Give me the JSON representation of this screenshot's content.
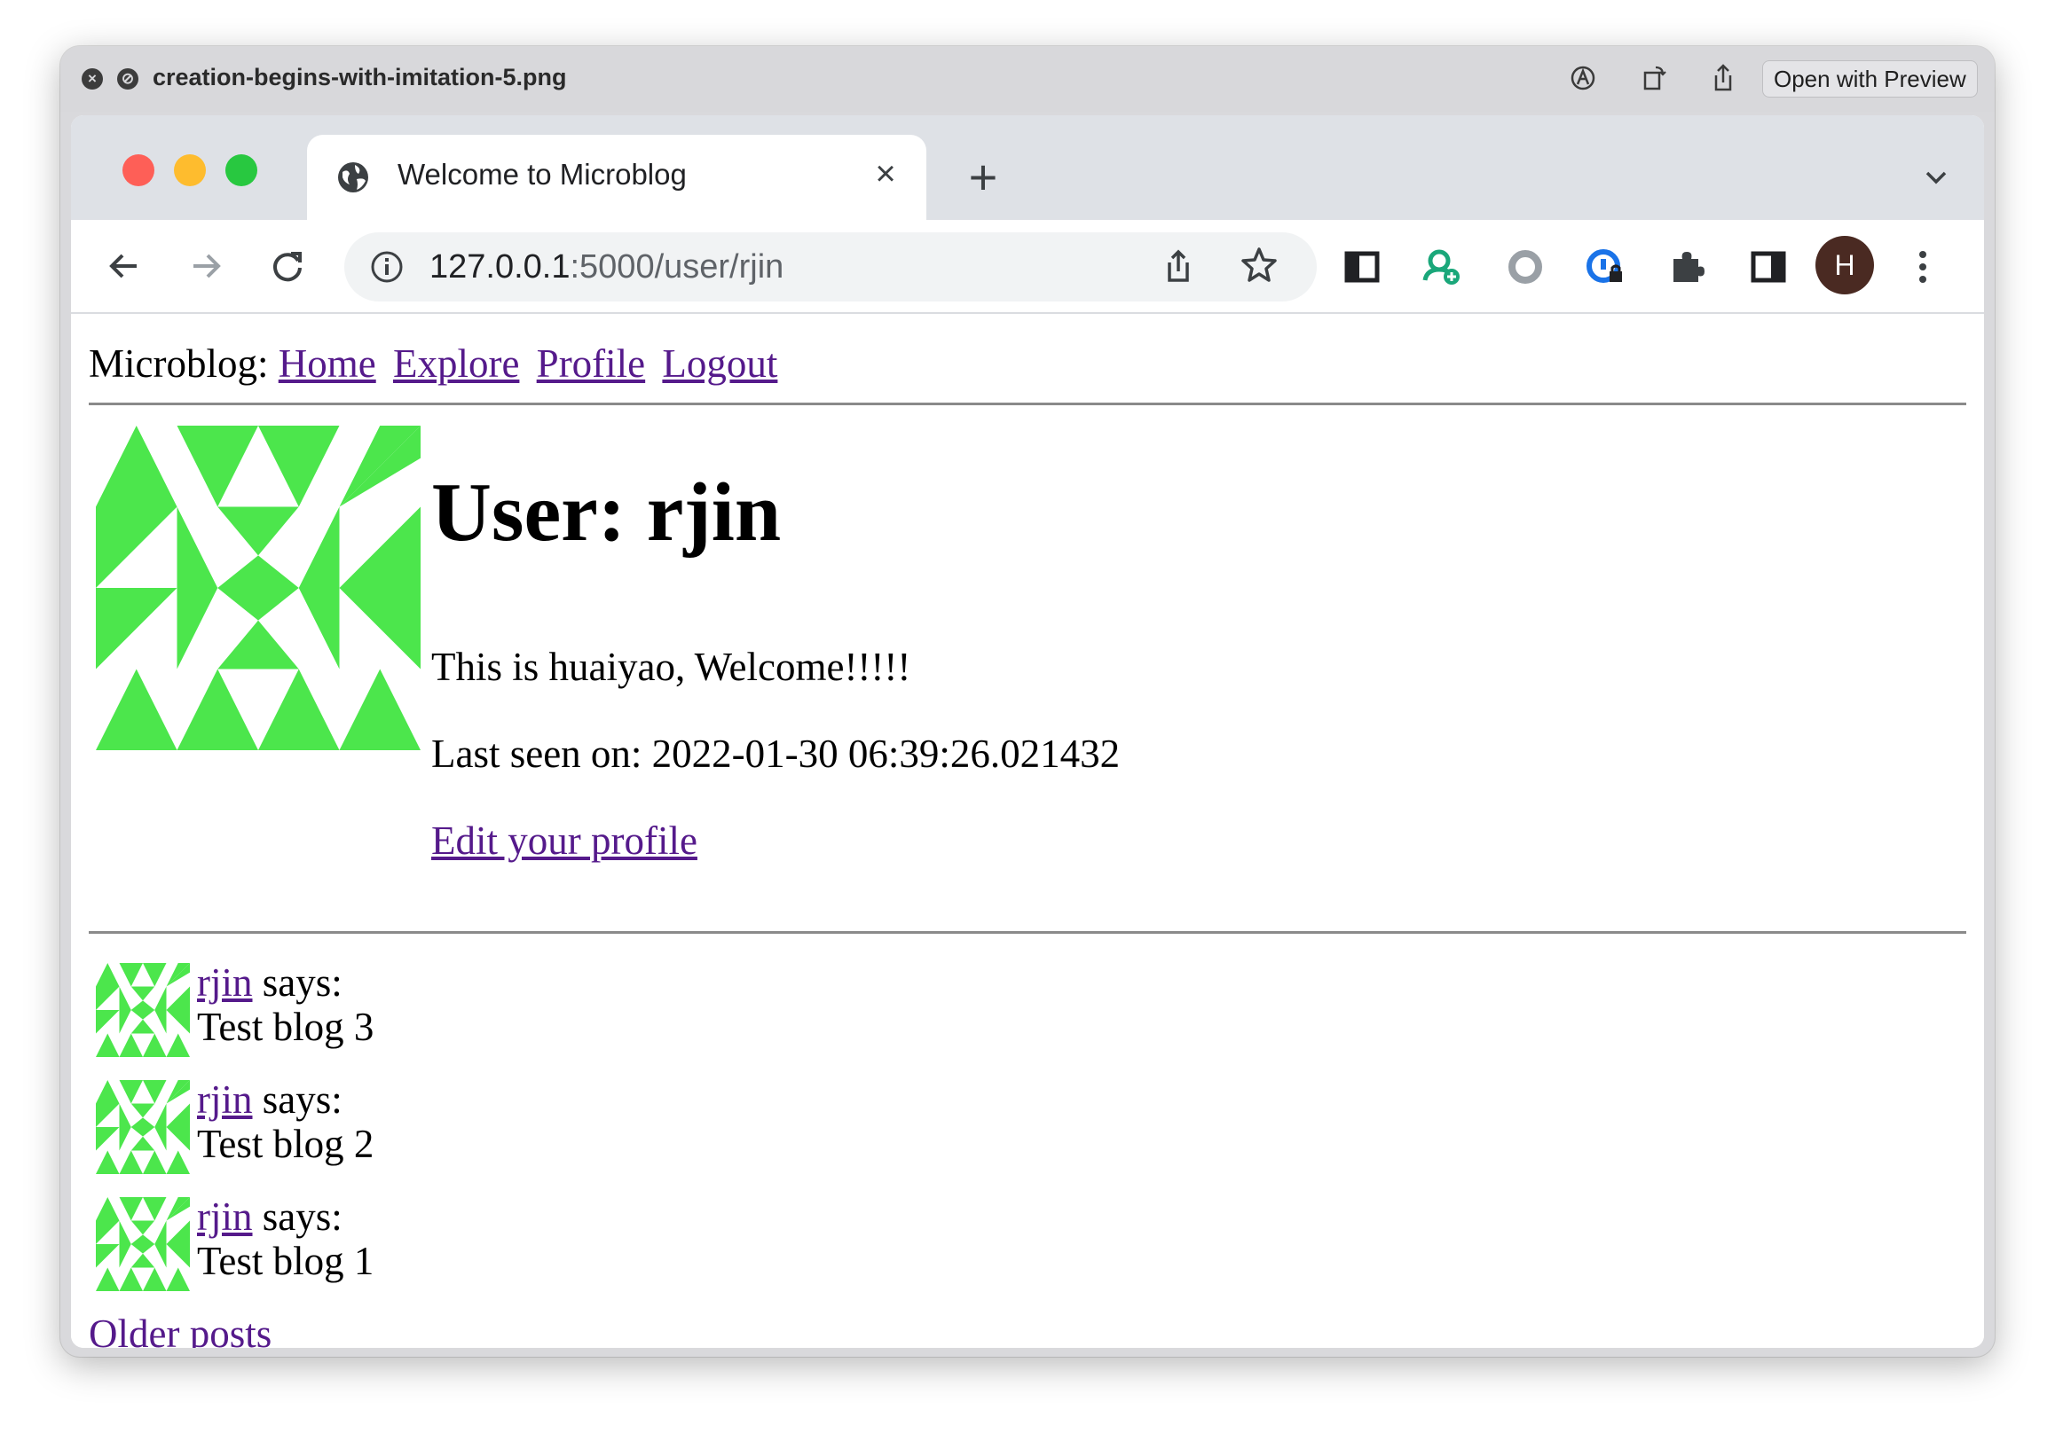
{
  "preview": {
    "filename": "creation-begins-with-imitation-5.png",
    "open_with_label": "Open with Preview"
  },
  "browser": {
    "tab_title": "Welcome to Microblog",
    "url_host": "127.0.0.1",
    "url_rest": ":5000/user/rjin",
    "profile_initial": "H"
  },
  "nav": {
    "brand": "Microblog:",
    "links": [
      "Home",
      "Explore",
      "Profile",
      "Logout"
    ]
  },
  "profile": {
    "heading": "User: rjin",
    "about_me": "This is huaiyao, Welcome!!!!!",
    "last_seen": "Last seen on: 2022-01-30 06:39:26.021432",
    "edit_link": "Edit your profile"
  },
  "posts": [
    {
      "author": "rjin",
      "says": " says:",
      "body": "Test blog 3"
    },
    {
      "author": "rjin",
      "says": " says:",
      "body": "Test blog 2"
    },
    {
      "author": "rjin",
      "says": " says:",
      "body": "Test blog 1"
    }
  ],
  "pagination": {
    "older_label": "Older posts"
  },
  "colors": {
    "avatar_green": "#4ce64c",
    "link": "#551a8b",
    "traffic_red": "#fe5f57",
    "traffic_yellow": "#febc2e",
    "traffic_green": "#28c840"
  }
}
